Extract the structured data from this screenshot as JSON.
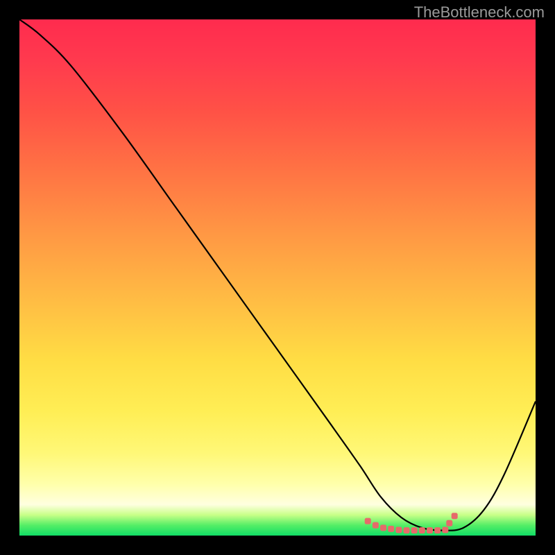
{
  "watermark": "TheBottleneck.com",
  "chart_data": {
    "type": "line",
    "title": "",
    "xlabel": "",
    "ylabel": "",
    "xlim": [
      0,
      100
    ],
    "ylim": [
      0,
      100
    ],
    "series": [
      {
        "name": "bottleneck-curve",
        "x": [
          0,
          4,
          10,
          20,
          30,
          40,
          50,
          60,
          66,
          70,
          74,
          78,
          82,
          86,
          90,
          94,
          100
        ],
        "y": [
          100,
          97,
          91,
          78,
          64,
          50,
          36,
          22,
          13.5,
          7.5,
          3.5,
          1.5,
          1.0,
          1.5,
          5,
          12,
          26
        ],
        "color": "#000000"
      }
    ],
    "markers": {
      "name": "optimal-range",
      "color": "#e66a6a",
      "points": [
        {
          "x": 67.5,
          "y": 2.8
        },
        {
          "x": 69.0,
          "y": 2.0
        },
        {
          "x": 70.5,
          "y": 1.5
        },
        {
          "x": 72.0,
          "y": 1.3
        },
        {
          "x": 73.5,
          "y": 1.1
        },
        {
          "x": 75.0,
          "y": 1.0
        },
        {
          "x": 76.5,
          "y": 1.0
        },
        {
          "x": 78.0,
          "y": 1.0
        },
        {
          "x": 79.5,
          "y": 1.0
        },
        {
          "x": 81.0,
          "y": 1.0
        },
        {
          "x": 82.5,
          "y": 1.1
        },
        {
          "x": 83.3,
          "y": 2.4
        },
        {
          "x": 84.3,
          "y": 3.8
        }
      ]
    },
    "background_gradient": {
      "type": "vertical",
      "stops": [
        {
          "pos": 0.0,
          "color": "#ff2b4e"
        },
        {
          "pos": 0.3,
          "color": "#ff7544"
        },
        {
          "pos": 0.66,
          "color": "#ffdd44"
        },
        {
          "pos": 0.9,
          "color": "#ffffaa"
        },
        {
          "pos": 0.96,
          "color": "#c8ff88"
        },
        {
          "pos": 1.0,
          "color": "#11dd66"
        }
      ]
    }
  }
}
